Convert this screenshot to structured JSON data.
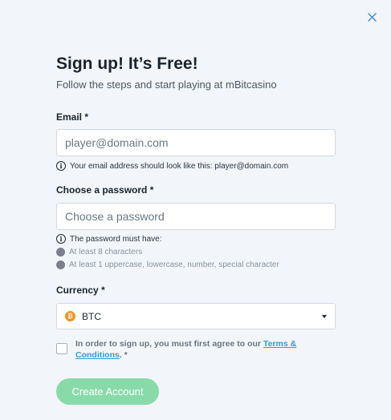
{
  "header": {
    "title": "Sign up! It’s Free!",
    "subtitle": "Follow the steps and start playing at mBitcasino"
  },
  "email": {
    "label": "Email *",
    "placeholder": "player@domain.com",
    "hint": "Your email address should look like this: player@domain.com"
  },
  "password": {
    "label": "Choose a password *",
    "placeholder": "Choose a password",
    "rules_title": "The password must have:",
    "rules": [
      "At least 8 characters",
      "At least 1 uppercase, lowercase, number, special character"
    ]
  },
  "currency": {
    "label": "Currency *",
    "selected": "BTC",
    "icon": "bitcoin-icon",
    "icon_glyph": "₿"
  },
  "terms": {
    "text_before": "In order to sign up, you must first agree to our ",
    "link_part1": "Terms &",
    "link_part2": "Conditions",
    "text_after": ". *"
  },
  "submit": {
    "label": "Create Account"
  },
  "icons": {
    "close": "close-icon",
    "info": "info-icon",
    "info_glyph": "i"
  },
  "colors": {
    "background": "#f2f5f9",
    "button": "#88dba9",
    "link": "#2f9ee0",
    "close": "#3a8fd0",
    "btc": "#f39322"
  }
}
